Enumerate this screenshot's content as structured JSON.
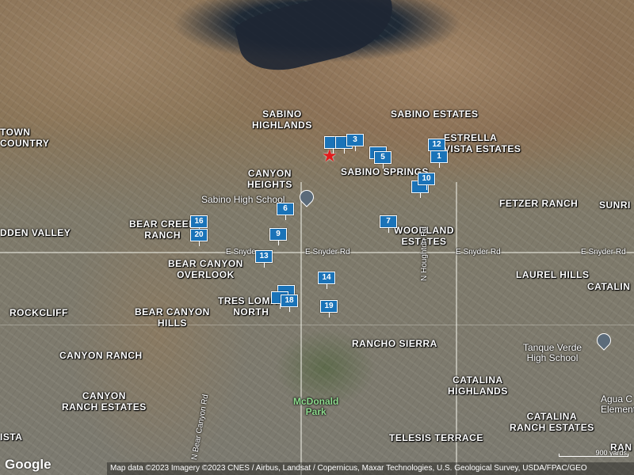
{
  "map": {
    "type": "satellite",
    "area_labels": [
      {
        "id": "sabino-highlands",
        "text": "SABINO\nHIGHLANDS"
      },
      {
        "id": "sabino-estates",
        "text": "SABINO ESTATES"
      },
      {
        "id": "estrella-vista-estates",
        "text": "ESTRELLA\nVISTA ESTATES"
      },
      {
        "id": "canyon-heights",
        "text": "CANYON\nHEIGHTS"
      },
      {
        "id": "sabino-springs",
        "text": "SABINO SPRINGS"
      },
      {
        "id": "fetzer-ranch",
        "text": "FETZER RANCH"
      },
      {
        "id": "sunrise",
        "text": "SUNRI"
      },
      {
        "id": "town-country",
        "text": "TOWN\nCOUNTRY"
      },
      {
        "id": "bear-creek-ranch",
        "text": "BEAR CREEK\nRANCH"
      },
      {
        "id": "hidden-valley",
        "text": "DDEN VALLEY"
      },
      {
        "id": "woodland-estates",
        "text": "WOODLAND\nESTATES"
      },
      {
        "id": "bear-canyon-overlook",
        "text": "BEAR CANYON\nOVERLOOK"
      },
      {
        "id": "laurel-hills",
        "text": "LAUREL HILLS"
      },
      {
        "id": "catalina",
        "text": "CATALIN"
      },
      {
        "id": "rockcliff",
        "text": "ROCKCLIFF"
      },
      {
        "id": "bear-canyon-hills",
        "text": "BEAR CANYON\nHILLS"
      },
      {
        "id": "tres-lomas-north",
        "text": "TRES LOMAS\nNORTH"
      },
      {
        "id": "rancho-sierra",
        "text": "RANCHO SIERRA"
      },
      {
        "id": "canyon-ranch",
        "text": "CANYON RANCH"
      },
      {
        "id": "catalina-highlands",
        "text": "CATALINA\nHIGHLANDS"
      },
      {
        "id": "canyon-ranch-estates",
        "text": "CANYON\nRANCH ESTATES"
      },
      {
        "id": "catalina-ranch-estates",
        "text": "CATALINA\nRANCH ESTATES"
      },
      {
        "id": "telesis-terrace",
        "text": "TELESIS TERRACE"
      },
      {
        "id": "vista",
        "text": "ISTA"
      },
      {
        "id": "ranch-right",
        "text": "RAN"
      }
    ],
    "road_labels": {
      "snyder_1": "E Snyder",
      "snyder_2": "E Snyder Rd",
      "snyder_3": "E Snyder Rd",
      "snyder_4": "E Snyder Rd",
      "houghton": "N Houghton Rd",
      "bear_canyon": "N Bear Canyon Rd"
    },
    "pois": {
      "sabino_high_school": "Sabino High School",
      "tanque_verde_high_school": "Tanque Verde\nHigh School",
      "mcdonald_park": "McDonald\nPark",
      "agua_caliente_elementary": "Agua C\nElementary"
    },
    "markers": [
      "3",
      "5",
      "12",
      "1",
      "10",
      "6",
      "16",
      "20",
      "9",
      "7",
      "13",
      "14",
      "18",
      "19",
      "17"
    ],
    "selected_location_icon": "star-icon"
  },
  "branding": {
    "logo_text": "Google"
  },
  "attribution": "Map data ©2023 Imagery ©2023 CNES / Airbus, Landsat / Copernicus, Maxar Technologies, U.S. Geological Survey, USDA/FPAC/GEO",
  "scale": {
    "label": "900 yards"
  },
  "colors": {
    "marker": "#1a73b8",
    "selected_star": "#e21b1b",
    "park_label": "#8fdc8f"
  }
}
